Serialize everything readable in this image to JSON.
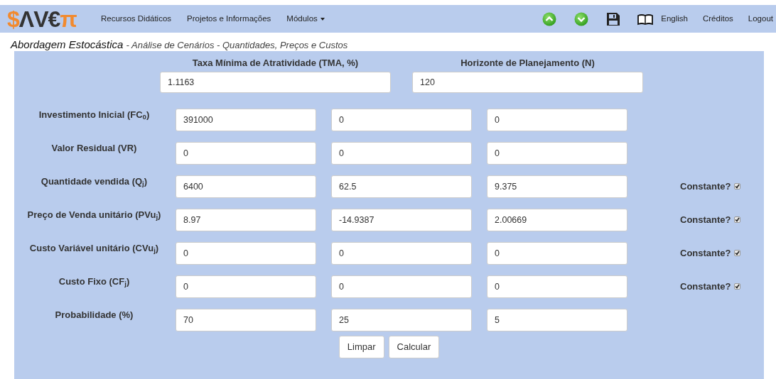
{
  "logo": {
    "parts": [
      {
        "text": "$",
        "accent": true
      },
      {
        "text": "ΛV€",
        "accent": false
      },
      {
        "text": "π",
        "accent": true
      }
    ]
  },
  "nav": [
    {
      "label": "Recursos Didáticos",
      "kind": "link"
    },
    {
      "label": "Projetos e Informações",
      "kind": "link"
    },
    {
      "label": "Módulos",
      "kind": "dropdown"
    }
  ],
  "nav_right": [
    {
      "kind": "up"
    },
    {
      "kind": "down"
    },
    {
      "kind": "save"
    },
    {
      "kind": "book"
    },
    {
      "kind": "text",
      "label": "English"
    },
    {
      "kind": "text",
      "label": "Créditos"
    },
    {
      "kind": "text",
      "label": "Logout"
    }
  ],
  "heading": {
    "title": "Abordagem Estocástica",
    "subtitle": "- Análise de Cenários - Quantidades, Preços e Custos"
  },
  "top_fields": [
    {
      "label": "Taxa Mínima de Atratividade (TMA, %)",
      "value": "1.1163"
    },
    {
      "label": "Horizonte de Planejamento (N)",
      "value": "120"
    }
  ],
  "rows": [
    {
      "label": "Investimento Inicial (FC$_{0}$)",
      "values": [
        "391000",
        "0",
        "0"
      ]
    },
    {
      "label": "Valor Residual (VR)",
      "values": [
        "0",
        "0",
        "0"
      ]
    },
    {
      "label": "Quantidade vendida (Q$_{j}$)",
      "values": [
        "6400",
        "62.5",
        "9.375"
      ],
      "constant": {
        "label": "Constante?",
        "checked": true
      }
    },
    {
      "label": "Preço de Venda unitário (PVu$_{j}$)",
      "values": [
        "8.97",
        "-14.9387",
        "2.00669"
      ],
      "constant": {
        "label": "Constante?",
        "checked": true
      }
    },
    {
      "label": "Custo Variável unitário (CVu$_{j}$)",
      "values": [
        "0",
        "0",
        "0"
      ],
      "constant": {
        "label": "Constante?",
        "checked": true
      }
    },
    {
      "label": "Custo Fixo (CF$_{j}$)",
      "values": [
        "0",
        "0",
        "0"
      ],
      "constant": {
        "label": "Constante?",
        "checked": true
      }
    },
    {
      "label": "Probabilidade (%)",
      "values": [
        "70",
        "25",
        "5"
      ]
    }
  ],
  "buttons": [
    "Limpar",
    "Calcular"
  ]
}
